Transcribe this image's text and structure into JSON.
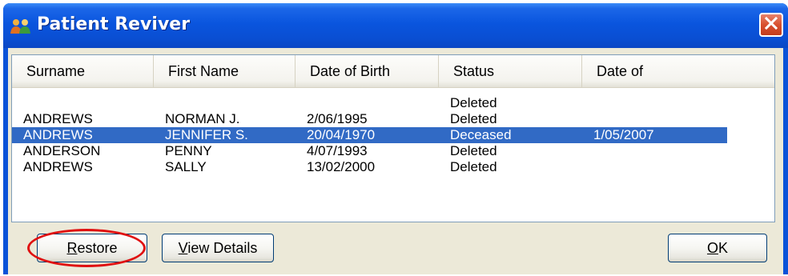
{
  "window": {
    "title": "Patient Reviver"
  },
  "icons": {
    "app": "patients-icon",
    "close": "close-icon"
  },
  "columns": [
    "Surname",
    "First Name",
    "Date of Birth",
    "Status",
    "Date of"
  ],
  "rows": [
    {
      "surname": "",
      "first_name": "",
      "dob": "",
      "status": "Deleted",
      "date_of": ""
    },
    {
      "surname": "ANDREWS",
      "first_name": "NORMAN J.",
      "dob": "2/06/1995",
      "status": "Deleted",
      "date_of": ""
    },
    {
      "surname": "ANDREWS",
      "first_name": "JENNIFER S.",
      "dob": "20/04/1970",
      "status": "Deceased",
      "date_of": "1/05/2007",
      "selected": true
    },
    {
      "surname": "ANDERSON",
      "first_name": "PENNY",
      "dob": "4/07/1993",
      "status": "Deleted",
      "date_of": ""
    },
    {
      "surname": "ANDREWS",
      "first_name": "SALLY",
      "dob": "13/02/2000",
      "status": "Deleted",
      "date_of": ""
    }
  ],
  "buttons": {
    "restore": {
      "access_key": "R",
      "rest": "estore"
    },
    "view_details": {
      "access_key": "V",
      "rest": "iew Details"
    },
    "ok": {
      "access_key": "O",
      "rest": "K"
    }
  },
  "colors": {
    "selection": "#316ac5",
    "highlight_ring": "#e01010"
  }
}
